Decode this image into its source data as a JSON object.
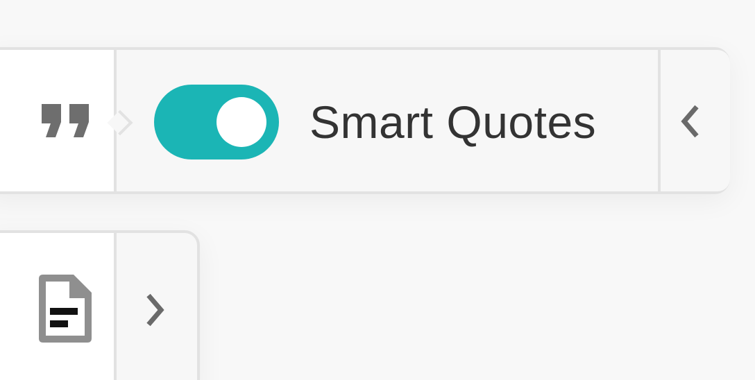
{
  "smart_quotes": {
    "label": "Smart Quotes",
    "enabled": true,
    "toggle_color": "#1bb5b5",
    "icon": "quote-icon",
    "collapse_icon": "chevron-left-icon"
  },
  "document_panel": {
    "icon": "document-icon",
    "expand_icon": "chevron-right-icon"
  }
}
